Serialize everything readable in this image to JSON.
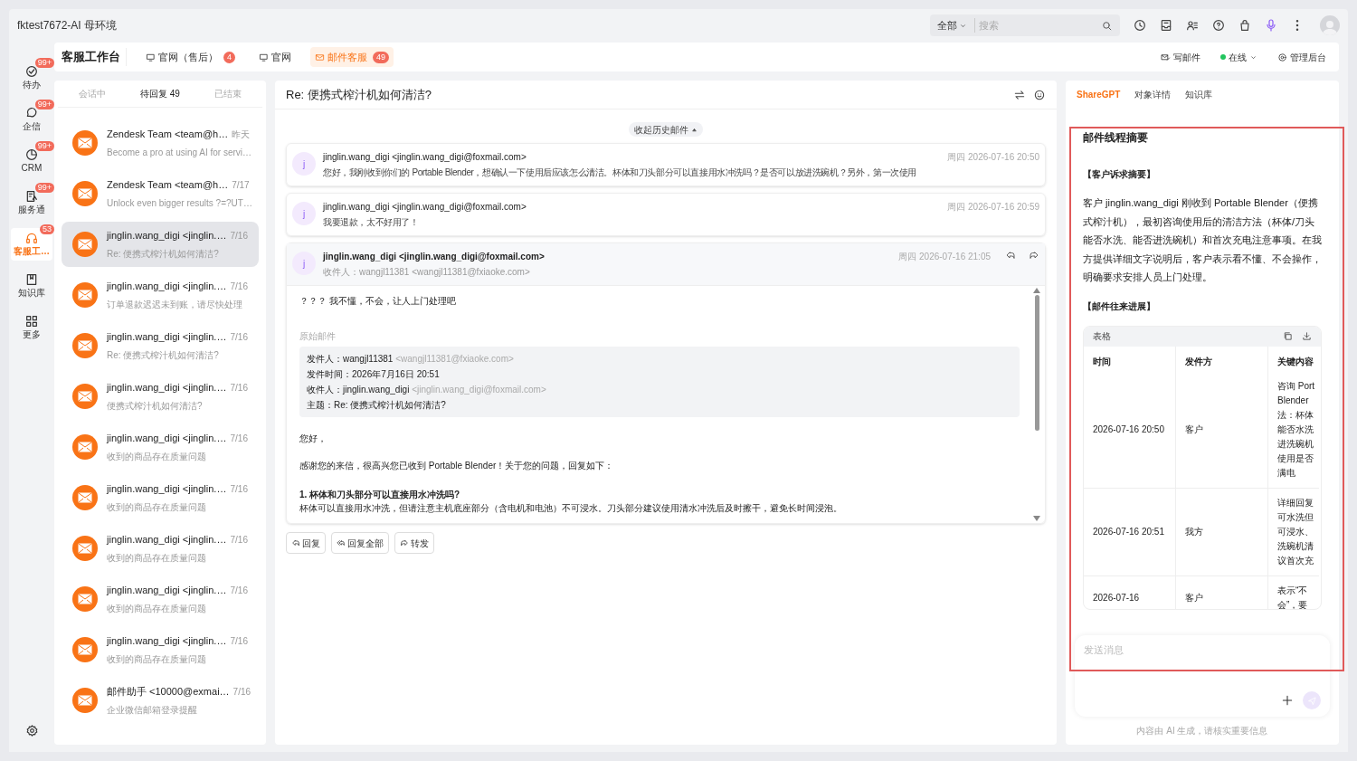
{
  "app_title": "fktest7672-AI 母环境",
  "search": {
    "scope": "全部",
    "placeholder": "搜索"
  },
  "nav": [
    {
      "kind": "todo",
      "label": "待办",
      "badge": "99+",
      "selected": false
    },
    {
      "kind": "chat",
      "label": "企信",
      "badge": "99+",
      "selected": false
    },
    {
      "kind": "crm",
      "label": "CRM",
      "badge": "99+",
      "selected": false
    },
    {
      "kind": "service",
      "label": "服务通",
      "badge": "99+",
      "selected": false
    },
    {
      "kind": "headset",
      "label": "客服工…",
      "badge": "53",
      "selected": true
    },
    {
      "kind": "book",
      "label": "知识库",
      "selected": false
    },
    {
      "kind": "grid",
      "label": "更多",
      "selected": false
    }
  ],
  "workbench": {
    "title": "客服工作台",
    "tabs": [
      {
        "kind": "monitor",
        "label": "官网（售后）",
        "badge": "4",
        "selected": false
      },
      {
        "kind": "monitor",
        "label": "官网",
        "selected": false
      },
      {
        "kind": "mail",
        "label": "邮件客服",
        "badge": "49",
        "selected": true
      }
    ],
    "actions": [
      {
        "kind": "compose",
        "label": "写邮件"
      },
      {
        "kind": "status",
        "label": "在线",
        "color": "#22c55e"
      },
      {
        "kind": "admin",
        "label": "管理后台"
      }
    ]
  },
  "conversation_tabs": [
    {
      "label": "会话中",
      "selected": false
    },
    {
      "label": "待回复 49",
      "selected": true
    },
    {
      "label": "已结束",
      "selected": false
    }
  ],
  "conversations": [
    {
      "sender": "Zendesk Team <team@h…",
      "date": "昨天",
      "preview": "Become a pro at using AI for servi…",
      "selected": false
    },
    {
      "sender": "Zendesk Team <team@h…",
      "date": "7/17",
      "preview": "Unlock even bigger results ?=?UT…",
      "selected": false
    },
    {
      "sender": "jinglin.wang_digi <jinglin.…",
      "date": "7/16",
      "preview": "Re: 便携式榨汁机如何清洁?",
      "selected": true
    },
    {
      "sender": "jinglin.wang_digi <jinglin.…",
      "date": "7/16",
      "preview": "订单退款迟迟未到账，请尽快处理",
      "selected": false
    },
    {
      "sender": "jinglin.wang_digi <jinglin.…",
      "date": "7/16",
      "preview": "Re: 便携式榨汁机如何清洁?",
      "selected": false
    },
    {
      "sender": "jinglin.wang_digi <jinglin.…",
      "date": "7/16",
      "preview": "便携式榨汁机如何清洁?",
      "selected": false
    },
    {
      "sender": "jinglin.wang_digi <jinglin.…",
      "date": "7/16",
      "preview": "收到的商品存在质量问题",
      "selected": false
    },
    {
      "sender": "jinglin.wang_digi <jinglin.…",
      "date": "7/16",
      "preview": "收到的商品存在质量问题",
      "selected": false
    },
    {
      "sender": "jinglin.wang_digi <jinglin.…",
      "date": "7/16",
      "preview": "收到的商品存在质量问题",
      "selected": false
    },
    {
      "sender": "jinglin.wang_digi <jinglin.…",
      "date": "7/16",
      "preview": "收到的商品存在质量问题",
      "selected": false
    },
    {
      "sender": "jinglin.wang_digi <jinglin.…",
      "date": "7/16",
      "preview": "收到的商品存在质量问题",
      "selected": false
    },
    {
      "sender": "邮件助手 <10000@exmai…",
      "date": "7/16",
      "preview": "企业微信邮箱登录提醒",
      "selected": false
    }
  ],
  "email": {
    "subject": "Re: 便携式榨汁机如何清洁?",
    "collapse_label": "收起历史邮件",
    "messages": [
      {
        "avatar": "j",
        "sender": "jinglin.wang_digi <jinglin.wang_digi@foxmail.com>",
        "time": "周四 2026-07-16 20:50",
        "preview": "您好，我刚收到你们的 Portable Blender，想确认一下使用后应该怎么清洁。杯体和刀头部分可以直接用水冲洗吗？是否可以放进洗碗机？另外，第一次使用",
        "expanded": false
      },
      {
        "avatar": "j",
        "sender": "jinglin.wang_digi <jinglin.wang_digi@foxmail.com>",
        "time": "周四 2026-07-16 20:59",
        "preview": "我要退款，太不好用了！",
        "expanded": false
      },
      {
        "avatar": "j",
        "sender": "jinglin.wang_digi <jinglin.wang_digi@foxmail.com>",
        "time": "周四 2026-07-16 21:05",
        "recipient": "收件人：wangjl11381 <wangjl11381@fxiaoke.com>",
        "expanded": true,
        "reply": "？？？ 我不懂，不会，让人上门处理吧",
        "quote_label": "原始邮件",
        "quote": [
          {
            "label": "发件人：",
            "value": "wangjl11381",
            "address": "<wangjl11381@fxiaoke.com>"
          },
          {
            "label": "发件时间：",
            "value": "2026年7月16日 20:51"
          },
          {
            "label": "收件人：",
            "value": "jinglin.wang_digi",
            "address": "<jinglin.wang_digi@foxmail.com>"
          },
          {
            "label": "主题：",
            "value": "Re: 便携式榨汁机如何清洁?"
          }
        ],
        "paragraphs": [
          {
            "kind": "text",
            "text": "您好，"
          },
          {
            "kind": "text",
            "text": "感谢您的来信，很高兴您已收到 Portable Blender！关于您的问题，回复如下："
          },
          {
            "kind": "heading",
            "text": "1. 杯体和刀头部分可以直接用水冲洗吗?"
          },
          {
            "kind": "line",
            "text": "杯体可以直接用水冲洗，但请注意主机底座部分（含电机和电池）不可浸水。刀头部分建议使用清水冲洗后及时擦干，避免长时间浸泡。"
          }
        ]
      }
    ],
    "buttons": [
      {
        "kind": "reply",
        "label": "回复"
      },
      {
        "kind": "reply_all",
        "label": "回复全部"
      },
      {
        "kind": "forward",
        "label": "转发"
      }
    ]
  },
  "assistant": {
    "tabs": [
      {
        "label": "ShareGPT",
        "selected": true
      },
      {
        "label": "对象详情",
        "selected": false
      },
      {
        "label": "知识库",
        "selected": false
      }
    ],
    "summary_title": "邮件线程摘要",
    "sections": [
      {
        "kind": "heading",
        "text": "【客户诉求摘要】"
      },
      {
        "kind": "text",
        "text": "客户 jinglin.wang_digi 刚收到 Portable Blender（便携式榨汁机），最初咨询使用后的清洁方法（杯体/刀头能否水洗、能否进洗碗机）和首次充电注意事项。在我方提供详细文字说明后，客户表示看不懂、不会操作，明确要求安排人员上门处理。"
      },
      {
        "kind": "heading",
        "text": "【邮件往来进展】"
      }
    ],
    "table": {
      "title": "表格",
      "columns": [
        "时间",
        "发件方",
        "关键内容"
      ],
      "rows": [
        [
          "2026-07-16 20:50",
          "客户",
          "咨询 Port Blender 法：杯体能否水洗进洗碗机使用是否满电"
        ],
        [
          "2026-07-16 20:51",
          "我方",
          "详细回复可水洗但可浸水、洗碗机清议首次充"
        ],
        [
          "2026-07-16",
          "客户",
          "表示“不会”，要"
        ]
      ]
    },
    "input_placeholder": "发送消息",
    "footer": "内容由 AI 生成，请核实重要信息"
  }
}
